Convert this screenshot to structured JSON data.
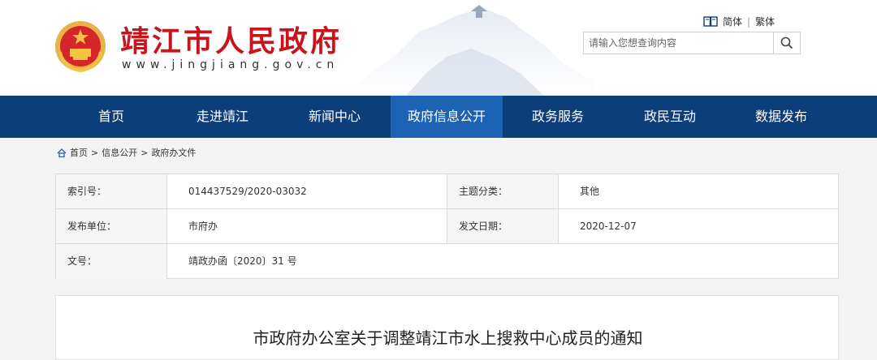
{
  "site": {
    "name": "靖江市人民政府",
    "url": "www.jingjiang.gov.cn"
  },
  "lang": {
    "simplified": "简体",
    "separator": "|",
    "traditional": "繁体"
  },
  "search": {
    "placeholder": "请输入您想查询内容"
  },
  "nav": {
    "items": [
      {
        "label": "首页"
      },
      {
        "label": "走进靖江"
      },
      {
        "label": "新闻中心"
      },
      {
        "label": "政府信息公开"
      },
      {
        "label": "政务服务"
      },
      {
        "label": "政民互动"
      },
      {
        "label": "数据发布"
      }
    ],
    "active_index": 3
  },
  "breadcrumb": {
    "home": "首页",
    "sep1": ">",
    "level1": "信息公开",
    "sep2": ">",
    "level2": "政府办文件"
  },
  "info": {
    "index_label": "索引号：",
    "index_value": "014437529/2020-03032",
    "topic_label": "主题分类：",
    "topic_value": "其他",
    "publisher_label": "发布单位：",
    "publisher_value": "市府办",
    "date_label": "发文日期：",
    "date_value": "2020-12-07",
    "doc_label": "文号：",
    "doc_value": "靖政办函〔2020〕31 号"
  },
  "article": {
    "title": "市政府办公室关于调整靖江市水上搜救中心成员的通知"
  },
  "colors": {
    "brand_red": "#c8141c",
    "nav_bg": "#0c3e7a",
    "nav_active": "#1c64b3"
  }
}
